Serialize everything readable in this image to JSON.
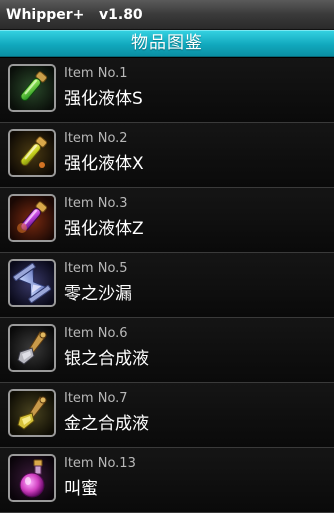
{
  "app": {
    "title": "Whipper+   v1.80"
  },
  "header": {
    "title": "物品图鉴"
  },
  "items": [
    {
      "number": "Item No.1",
      "name": "强化液体S",
      "icon": "green-potion-vial-icon"
    },
    {
      "number": "Item No.2",
      "name": "强化液体X",
      "icon": "yellow-potion-vial-icon"
    },
    {
      "number": "Item No.3",
      "name": "强化液体Z",
      "icon": "purple-potion-vial-icon"
    },
    {
      "number": "Item No.5",
      "name": "零之沙漏",
      "icon": "hourglass-icon"
    },
    {
      "number": "Item No.6",
      "name": "银之合成液",
      "icon": "silver-tool-icon"
    },
    {
      "number": "Item No.7",
      "name": "金之合成液",
      "icon": "gold-tool-icon"
    },
    {
      "number": "Item No.13",
      "name": "叫蜜",
      "icon": "pink-potion-bottle-icon"
    }
  ]
}
